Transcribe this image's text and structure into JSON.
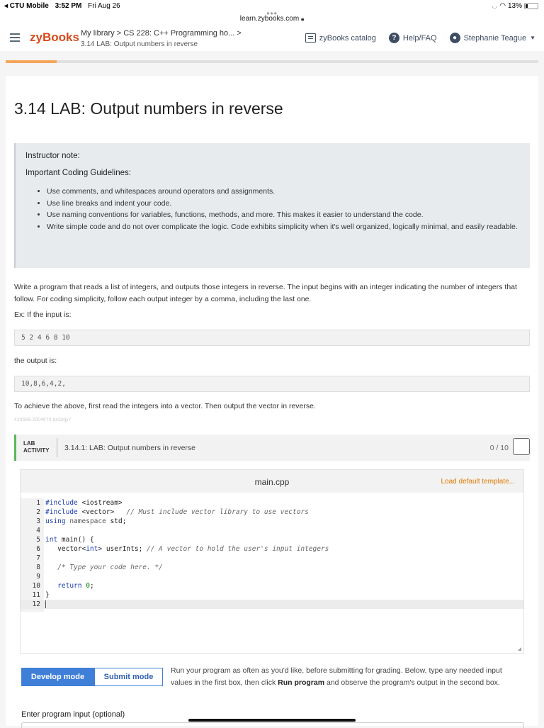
{
  "status": {
    "carrier": "◂ CTU Mobile",
    "time": "3:52 PM",
    "date": "Fri Aug 26",
    "battery": "13%"
  },
  "browser": {
    "url": "learn.zybooks.com"
  },
  "header": {
    "logo": "zyBooks",
    "breadcrumb": "My library > CS 228: C++ Programming ho... >",
    "section": "3.14 LAB: Output numbers in reverse",
    "catalog": "zyBooks catalog",
    "help": "Help/FAQ",
    "user": "Stephanie Teague"
  },
  "page": {
    "title": "3.14 LAB: Output numbers in reverse",
    "note_title": "Instructor note:",
    "note_sub": "Important Coding Guidelines:",
    "guidelines": [
      "Use comments, and whitespaces around operators and assignments.",
      "Use line breaks and indent your code.",
      "Use naming conventions for variables, functions, methods, and more. This makes it easier to understand the code.",
      "Write simple code and do not over complicate the logic. Code exhibits simplicity when it's well organized, logically minimal, and easily readable."
    ],
    "description": "Write a program that reads a list of integers, and outputs those integers in reverse. The input begins with an integer indicating the number of integers that follow. For coding simplicity, follow each output integer by a comma, including the last one.",
    "example_label": "Ex: If the input is:",
    "example_input": "5 2 4 6 8 10",
    "output_label": "the output is:",
    "example_output": "10,8,6,4,2,",
    "achieve": "To achieve the above, first read the integers into a vector. Then output the vector in reverse.",
    "tiny_id": "424668.2004674.qx3zqy7"
  },
  "lab": {
    "tag_line1": "LAB",
    "tag_line2": "ACTIVITY",
    "title": "3.14.1: LAB: Output numbers in reverse",
    "score": "0 / 10",
    "filename": "main.cpp",
    "load_template": "Load default template...",
    "line_numbers": [
      "1",
      "2",
      "3",
      "4",
      "5",
      "6",
      "7",
      "8",
      "9",
      "10",
      "11",
      "12"
    ],
    "develop_mode": "Develop mode",
    "submit_mode": "Submit mode",
    "run_desc_1": "Run your program as often as you'd like, before submitting for grading. Below, type any needed input values in the first box, then click ",
    "run_desc_bold": "Run program",
    "run_desc_2": " and observe the program's output in the second box.",
    "input_label": "Enter program input (optional)"
  }
}
